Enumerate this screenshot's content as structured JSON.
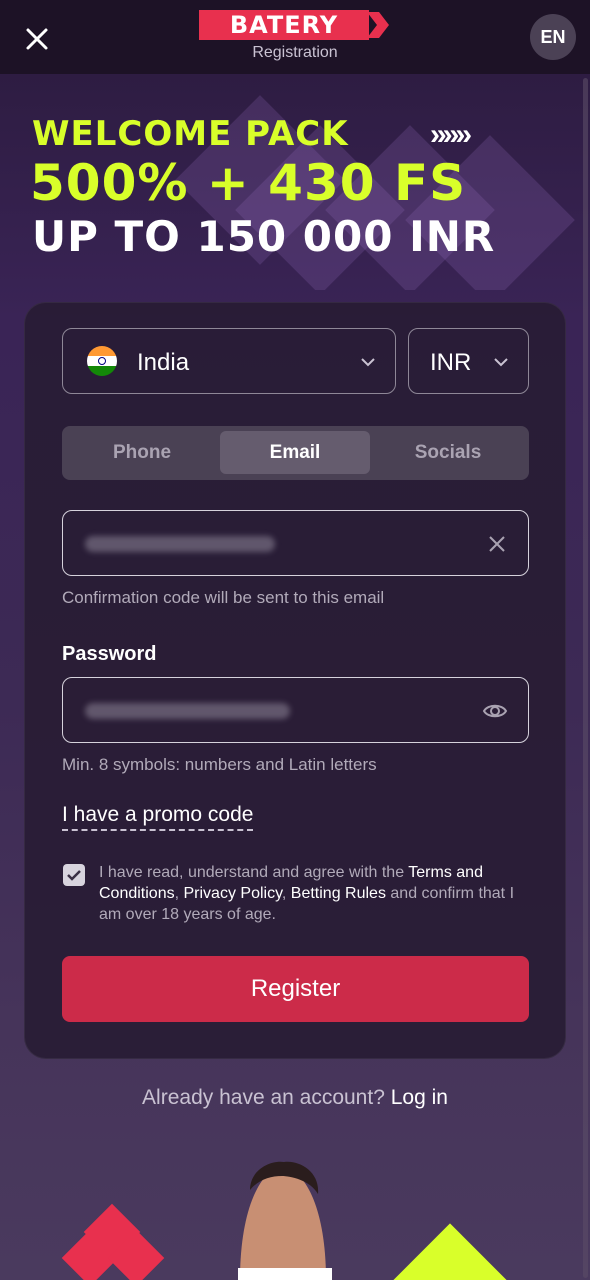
{
  "header": {
    "logo_text": "BATERY",
    "subtitle": "Registration",
    "language": "EN"
  },
  "promo": {
    "line1": "WELCOME PACK",
    "chevrons": "»»»",
    "line2": "500% + 430 FS",
    "line3": "UP TO 150 000 INR"
  },
  "form": {
    "country": "India",
    "currency": "INR",
    "tabs": [
      "Phone",
      "Email",
      "Socials"
    ],
    "active_tab": "Email",
    "email_hint": "Confirmation code will be sent to this email",
    "password_label": "Password",
    "password_hint": "Min. 8 symbols: numbers and Latin letters",
    "promo_link": "I have a promo code",
    "agree": {
      "prefix": "I have read, understand and agree with the ",
      "terms": "Terms and Conditions",
      "sep1": ", ",
      "privacy": "Privacy Policy",
      "sep2": ", ",
      "rules": "Betting Rules",
      "suffix": " and confirm that I am over 18 years of age."
    },
    "checkbox_checked": true,
    "register_label": "Register"
  },
  "footer": {
    "login_prompt": "Already have an account?",
    "login_link": "Log in"
  },
  "colors": {
    "accent": "#cc2b49",
    "lime": "#d9ff2a",
    "brand": "#e8304e"
  },
  "icons": {
    "close": "close-icon",
    "chevron": "chevron-down-icon",
    "clear": "clear-icon",
    "eye": "eye-icon",
    "check": "check-icon",
    "flag": "india-flag-icon"
  }
}
